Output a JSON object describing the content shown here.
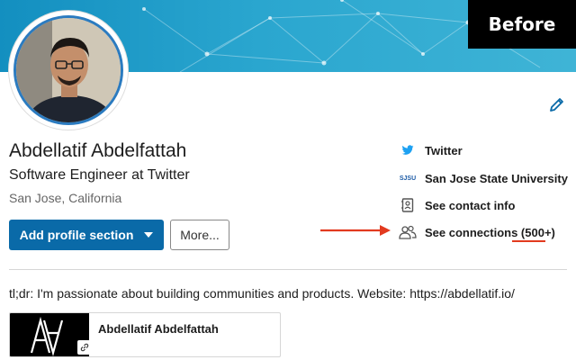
{
  "badge": "Before",
  "profile": {
    "name": "Abdellatif Abdelfattah",
    "headline": "Software Engineer at Twitter",
    "location": "San Jose, California"
  },
  "actions": {
    "primary_label": "Add profile section",
    "more_label": "More..."
  },
  "contact_links": [
    {
      "label": "Twitter",
      "icon": "twitter-bird-icon"
    },
    {
      "label": "San Jose State University",
      "icon": "sjsu-logo",
      "logo_text": "SJSU"
    },
    {
      "label": "See contact info",
      "icon": "contact-card-icon"
    },
    {
      "label": "See connections (500+)",
      "icon": "people-icon"
    }
  ],
  "about": "tl;dr: I'm passionate about building communities and products. Website: https://abdellatif.io/",
  "featured": {
    "title": "Abdellatif Abdelfattah"
  },
  "colors": {
    "banner": "#2aa6cf",
    "primary_button": "#0a6aa8",
    "annotation": "#e23a1f",
    "twitter": "#1da1f2"
  }
}
